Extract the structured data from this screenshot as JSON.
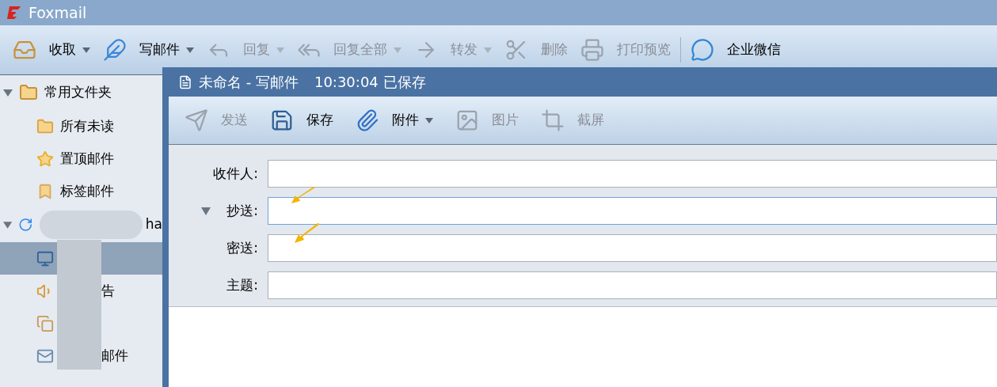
{
  "window": {
    "title": "Foxmail"
  },
  "toolbar": [
    {
      "label": "收取",
      "dropdown": true,
      "disabled": false
    },
    {
      "label": "写邮件",
      "dropdown": true,
      "disabled": false
    },
    {
      "label": "回复",
      "dropdown": true,
      "disabled": true
    },
    {
      "label": "回复全部",
      "dropdown": true,
      "disabled": true
    },
    {
      "label": "转发",
      "dropdown": true,
      "disabled": true
    },
    {
      "label": "删除",
      "dropdown": false,
      "disabled": true
    },
    {
      "label": "打印预览",
      "dropdown": false,
      "disabled": true
    },
    {
      "label": "企业微信",
      "dropdown": false,
      "disabled": false
    }
  ],
  "sidebar": [
    {
      "label": "常用文件夹",
      "expanded": true,
      "children": [
        {
          "label": "所有未读",
          "selected": false
        },
        {
          "label": "置顶邮件",
          "selected": false
        },
        {
          "label": "标签邮件",
          "selected": false
        }
      ]
    },
    {
      "label": "ha",
      "expanded": true,
      "children": [
        {
          "selected": true
        },
        {
          "label": "告",
          "selected": false
        },
        {
          "selected": false
        },
        {
          "label": "邮件",
          "selected": false
        }
      ]
    }
  ],
  "compose": {
    "title": "未命名 - 写邮件",
    "saved": "10:30:04 已保存",
    "toolbar": [
      {
        "label": "发送",
        "dropdown": false,
        "disabled": true
      },
      {
        "label": "保存",
        "dropdown": false,
        "disabled": false
      },
      {
        "label": "附件",
        "dropdown": true,
        "disabled": false
      },
      {
        "label": "图片",
        "dropdown": false,
        "disabled": true
      },
      {
        "label": "截屏",
        "dropdown": false,
        "disabled": true
      }
    ],
    "fields": [
      {
        "label": "收件人:",
        "focused": false
      },
      {
        "label": "抄送:",
        "focused": true,
        "expander": true
      },
      {
        "label": "密送:",
        "focused": false
      },
      {
        "label": "主题:",
        "focused": false
      }
    ]
  }
}
